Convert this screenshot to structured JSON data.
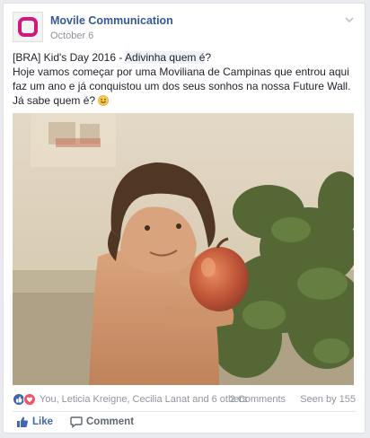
{
  "post": {
    "page_name": "Movile Communication",
    "date": "October 6",
    "text_prefix": "[BRA] Kid's Day 2016 - ",
    "text_highlight": "Adivinha quem é",
    "text_after_highlight": "?",
    "text_body": "Hoje vamos começar por uma Moviliana de Campinas que entrou aqui faz um ano e já conquistou um dos seus sonhos na nossa Future Wall. Já sabe quem é? ",
    "emoji": "smile-emoji"
  },
  "stats": {
    "reactions_names": "You, Leticia Kreigne, Cecilia Lanat and 6 others",
    "comments": "2 Comments",
    "seen": "Seen by 155"
  },
  "actions": {
    "like": "Like",
    "comment": "Comment"
  },
  "colors": {
    "brand": "#d3187d",
    "link": "#365899",
    "like_blue": "#4267b2",
    "love_red": "#f25268"
  }
}
